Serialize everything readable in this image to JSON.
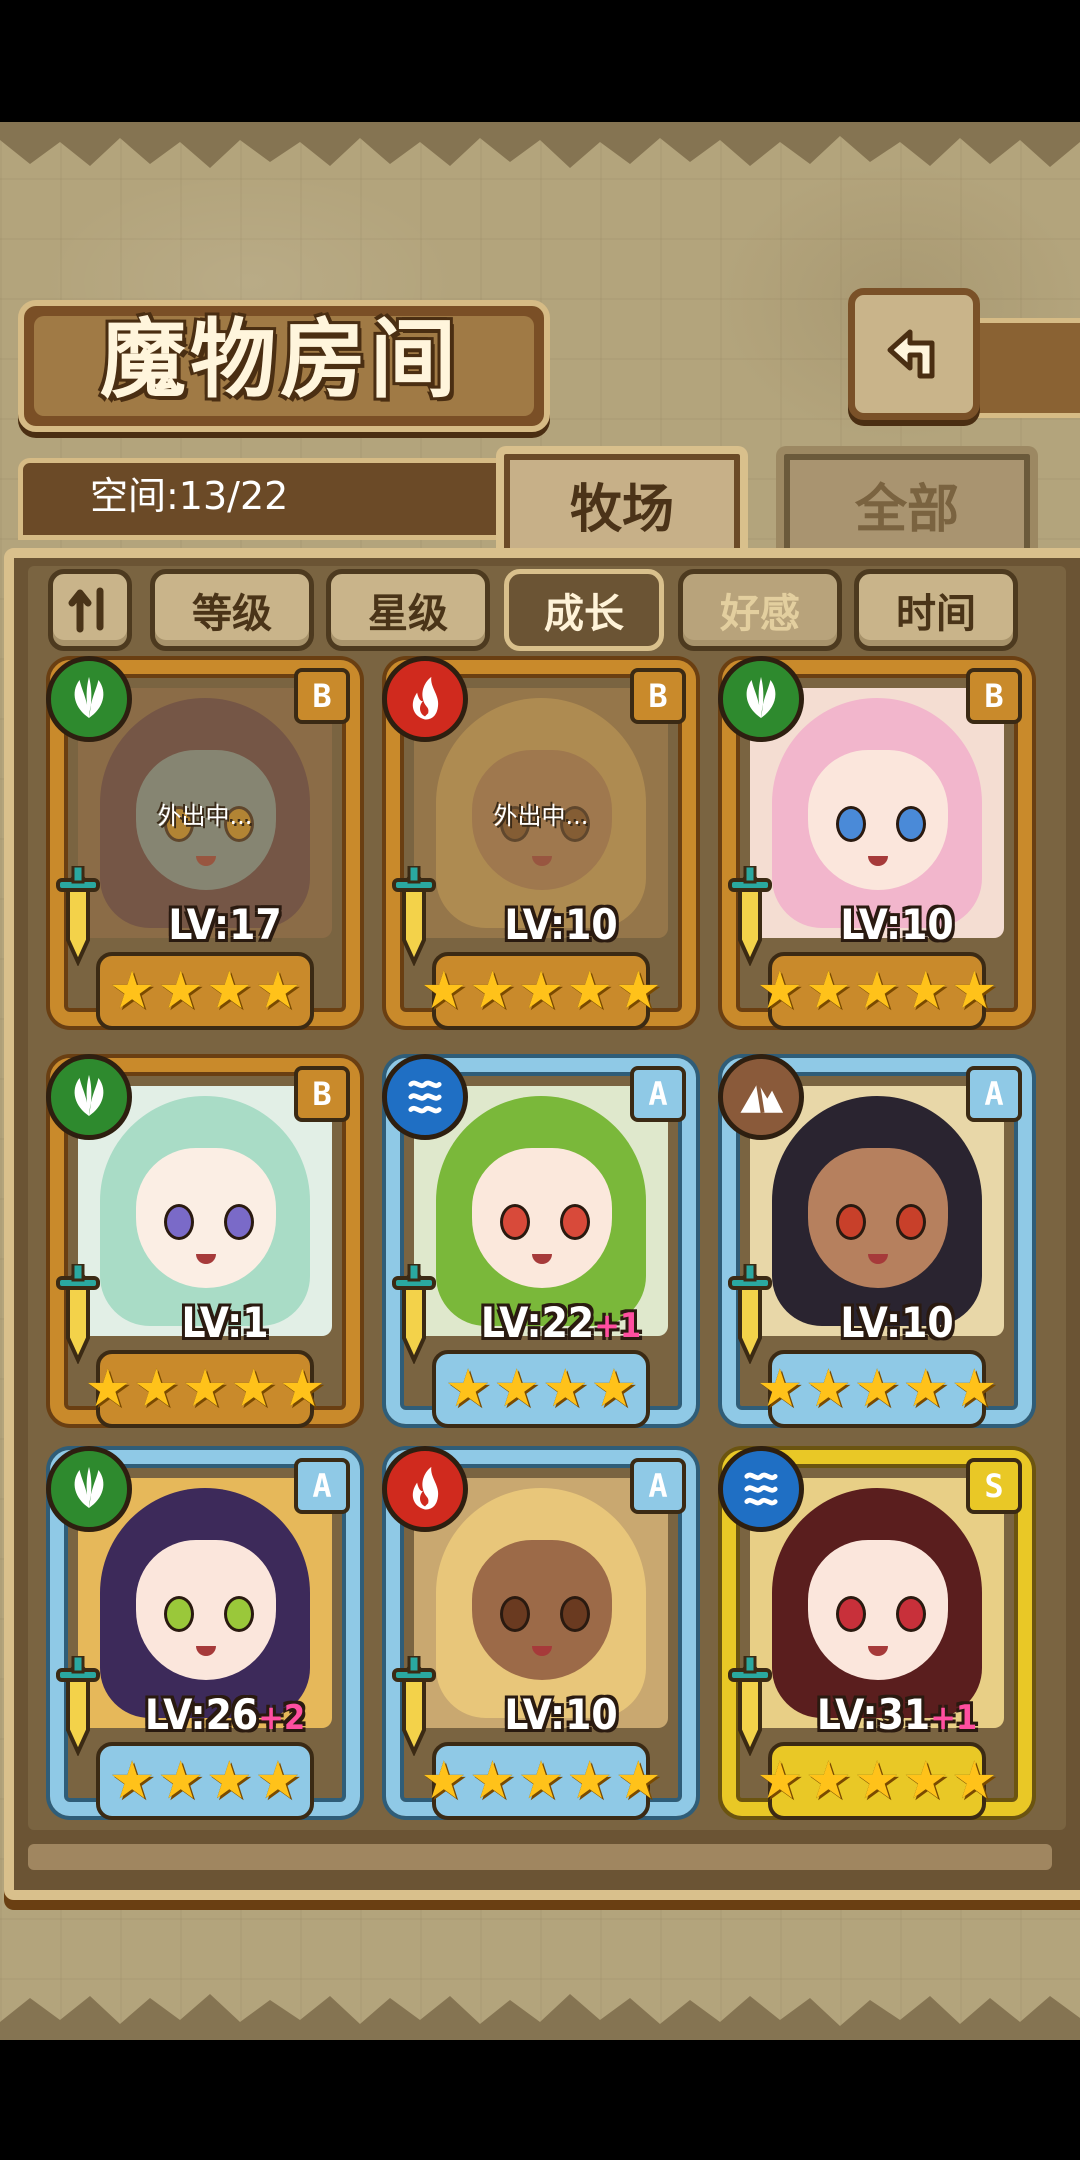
{
  "title": "魔物房间",
  "space": "空间:13/22",
  "tabs": {
    "ranch": "牧场",
    "all": "全部"
  },
  "sort": {
    "order_icon": "sort-order-icon",
    "buttons": [
      "等级",
      "星级",
      "成长",
      "好感",
      "时间"
    ],
    "active": "成长"
  },
  "cards": [
    {
      "element": "leaf",
      "rank": "B",
      "level": "LV:17",
      "bonus": "",
      "stars": 4,
      "status": "外出中...",
      "frame": "gold"
    },
    {
      "element": "fire",
      "rank": "B",
      "level": "LV:10",
      "bonus": "",
      "stars": 5,
      "status": "外出中...",
      "frame": "gold"
    },
    {
      "element": "leaf",
      "rank": "B",
      "level": "LV:10",
      "bonus": "",
      "stars": 5,
      "status": "",
      "frame": "gold"
    },
    {
      "element": "leaf",
      "rank": "B",
      "level": "LV:1",
      "bonus": "",
      "stars": 5,
      "status": "",
      "frame": "gold"
    },
    {
      "element": "water",
      "rank": "A",
      "level": "LV:22",
      "bonus": "+1",
      "stars": 4,
      "status": "",
      "frame": "blue"
    },
    {
      "element": "earth",
      "rank": "A",
      "level": "LV:10",
      "bonus": "",
      "stars": 5,
      "status": "",
      "frame": "blue"
    },
    {
      "element": "leaf",
      "rank": "A",
      "level": "LV:26",
      "bonus": "+2",
      "stars": 4,
      "status": "",
      "frame": "blue"
    },
    {
      "element": "fire",
      "rank": "A",
      "level": "LV:10",
      "bonus": "",
      "stars": 5,
      "status": "",
      "frame": "blue"
    },
    {
      "element": "water",
      "rank": "S",
      "level": "LV:31",
      "bonus": "+1",
      "stars": 5,
      "status": "",
      "frame": "yellow"
    }
  ],
  "colors": {
    "leaf": "#2e8a2e",
    "fire": "#d02a1e",
    "water": "#1f6fc4",
    "earth": "#8a5a3a"
  }
}
